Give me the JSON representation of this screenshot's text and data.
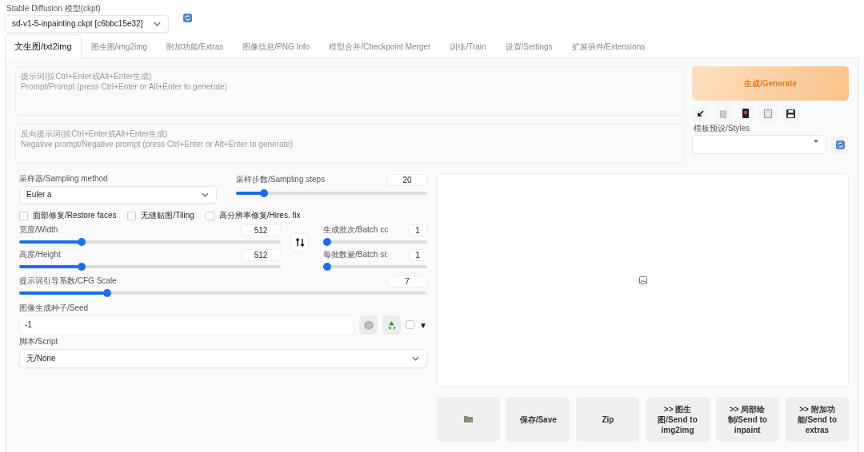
{
  "model": {
    "label": "Stable Diffusion 模型(ckpt)",
    "value": "sd-v1-5-inpainting.ckpt [c6bbc15e32]"
  },
  "tabs": [
    {
      "label": "文生图/txt2img",
      "selected": true
    },
    {
      "label": "图生图/img2img",
      "selected": false
    },
    {
      "label": "附加功能/Extras",
      "selected": false
    },
    {
      "label": "图像信息/PNG Info",
      "selected": false
    },
    {
      "label": "模型合并/Checkpoint Merger",
      "selected": false
    },
    {
      "label": "训练/Train",
      "selected": false
    },
    {
      "label": "设置/Settings",
      "selected": false
    },
    {
      "label": "扩展插件/Extensions",
      "selected": false
    }
  ],
  "prompt": {
    "placeholder": "提示词(按Ctrl+Enter或Alt+Enter生成)\nPrompt/Prompt (press Ctrl+Enter or Alt+Enter to generate)"
  },
  "negative_prompt": {
    "placeholder": "反向提示词(按Ctrl+Enter或Alt+Enter生成)\nNegative prompt/Negative prompt (press Ctrl+Enter or Alt+Enter to generate)"
  },
  "generate_button": "生成/Generate",
  "styles": {
    "label": "模板预设/Styles"
  },
  "sampler": {
    "label": "采样器/Sampling method",
    "value": "Euler a"
  },
  "steps": {
    "label": "采样步数/Sampling steps",
    "value": "20",
    "level": 0.13
  },
  "checkboxes": [
    {
      "label": "面部修复/Restore faces",
      "checked": false
    },
    {
      "label": "无缝贴图/Tiling",
      "checked": false
    },
    {
      "label": "高分辨率修复/Hires. fix",
      "checked": false
    }
  ],
  "width": {
    "label": "宽度/Width",
    "value": "512",
    "level": 0.23
  },
  "height": {
    "label": "高度/Height",
    "value": "512",
    "level": 0.23
  },
  "batch_count": {
    "label": "生成批次/Batch cc",
    "value": "1",
    "level": 0
  },
  "batch_size": {
    "label": "每批数量/Batch si:",
    "value": "1",
    "level": 0
  },
  "cfg": {
    "label": "提示词引导系数/CFG Scale",
    "value": "7",
    "level": 0.21
  },
  "seed": {
    "label": "图像生成种子/Seed",
    "value": "-1",
    "extra_checked": false,
    "toggle": "▼"
  },
  "script": {
    "label": "脚本/Script",
    "value": "无/None"
  },
  "output_buttons": [
    {
      "kind": "folder"
    },
    {
      "kind": "text",
      "label": "保存/Save"
    },
    {
      "kind": "text",
      "label": "Zip"
    },
    {
      "kind": "text",
      "label": ">> 图生图/Send to img2img"
    },
    {
      "kind": "text",
      "label": ">> 局部绘制/Send to inpaint"
    },
    {
      "kind": "text",
      "label": ">> 附加功能/Send to extras"
    }
  ]
}
